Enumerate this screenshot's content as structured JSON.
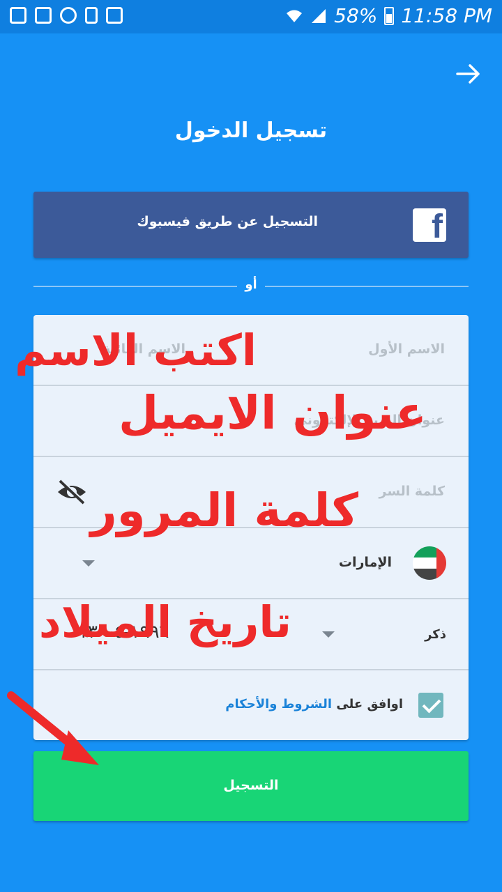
{
  "status_bar": {
    "battery": "58%",
    "time": "11:58 PM"
  },
  "header": {
    "title": "تسجيل الدخول"
  },
  "facebook": {
    "label": "التسجيل عن طريق فيسبوك",
    "icon_letter": "f"
  },
  "divider": {
    "text": "أو"
  },
  "form": {
    "first_name_placeholder": "الاسم الأول",
    "family_name_placeholder": "الاسم العائلة",
    "email_placeholder": "عنوان البريد الإلكتروني",
    "password_placeholder": "كلمة السر",
    "country": "الإمارات",
    "gender": "ذكر",
    "birthdate": "١٩٩٦-٠٤-١٣",
    "terms_prefix": "اوافق على",
    "terms_link": "الشروط والأحكام",
    "terms_checked": true
  },
  "submit": {
    "label": "التسجيل"
  },
  "annotations": {
    "name": "اكتب الاسم",
    "email": "عنوان الايميل",
    "password": "كلمة المرور",
    "birthdate": "تاريخ الميلاد"
  },
  "colors": {
    "background": "#1691f5",
    "facebook": "#3c5a99",
    "submit": "#18d576",
    "annotation": "#ee2a2a"
  }
}
